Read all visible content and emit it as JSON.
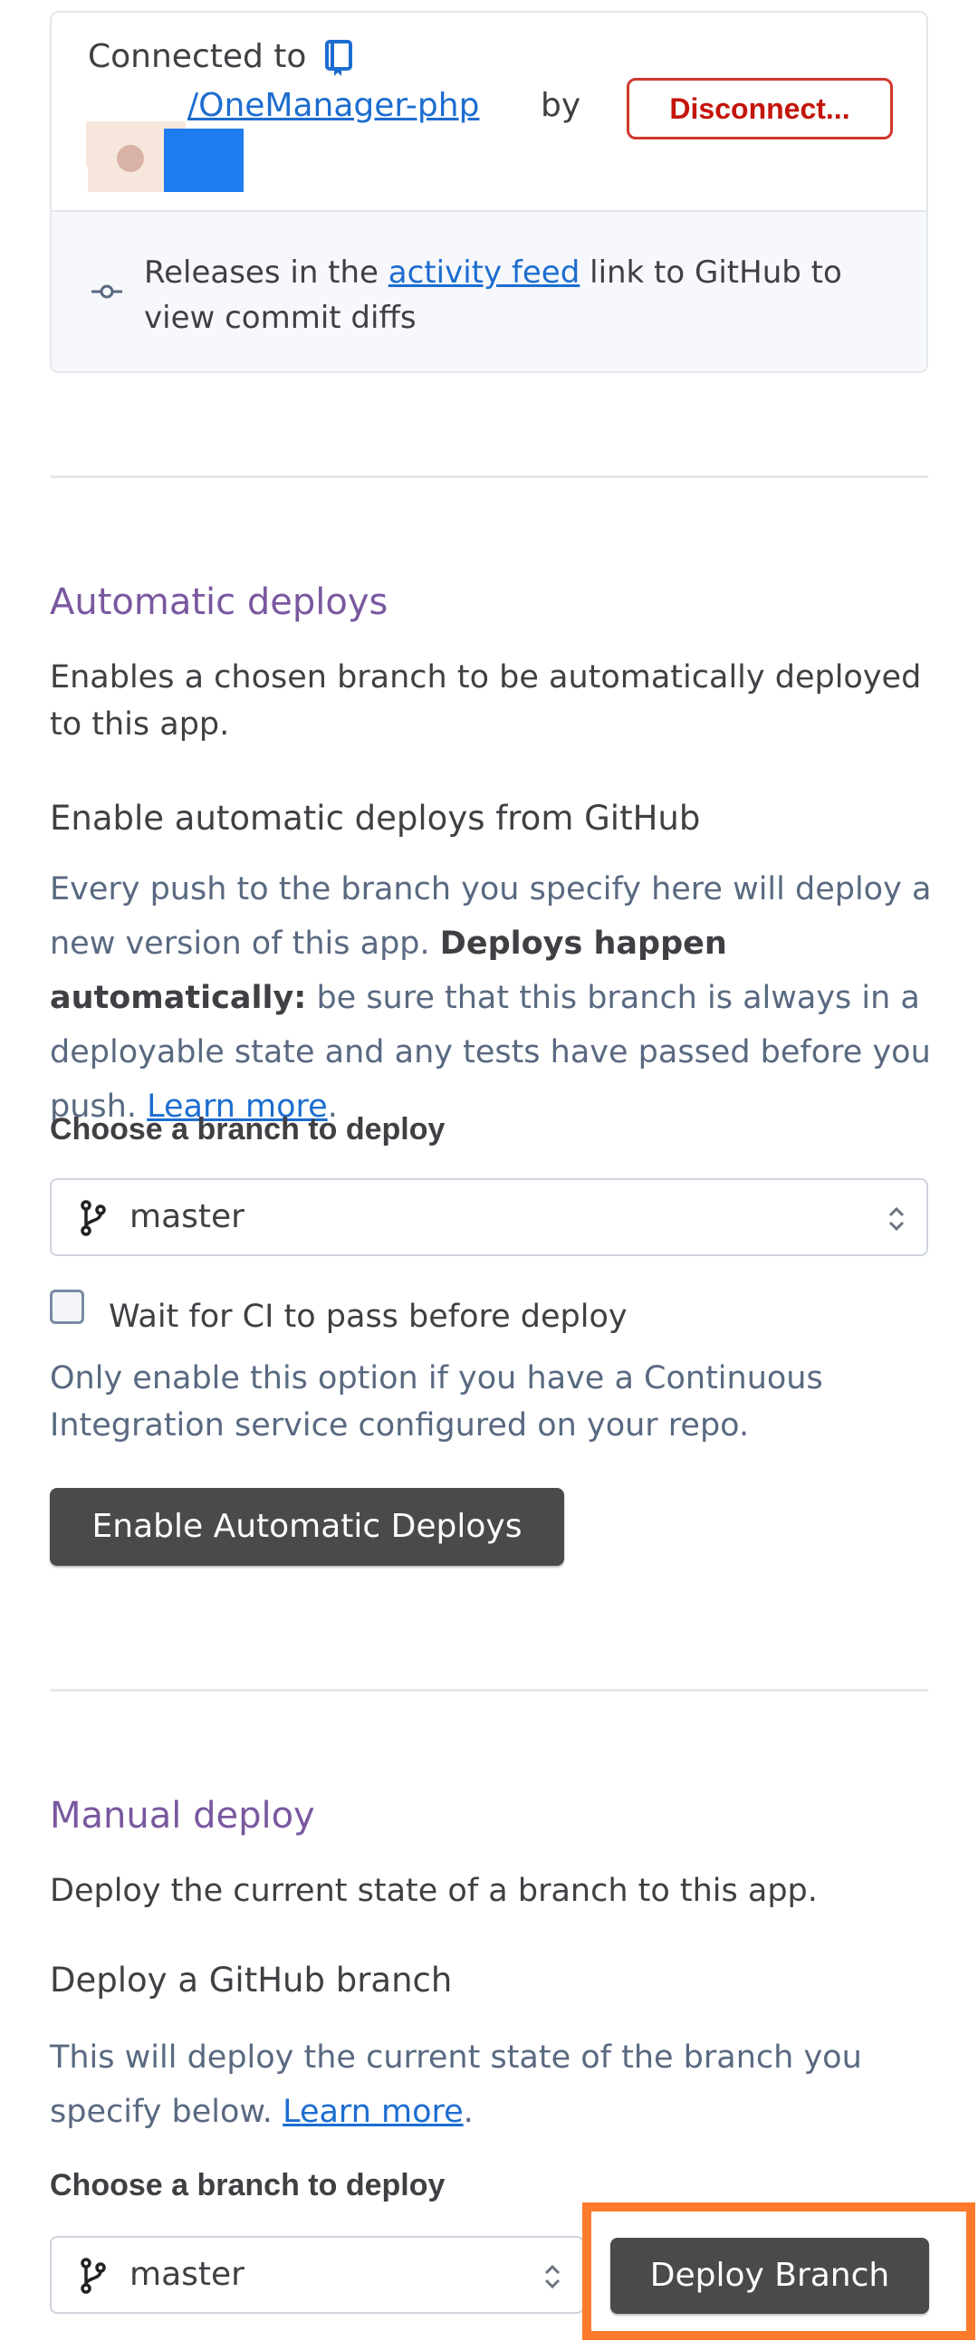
{
  "github_connection": {
    "connected_label": "Connected to",
    "repo_name": "/OneManager-php",
    "by_label": "by",
    "disconnect_label": "Disconnect...",
    "release_text_prefix": "Releases in the ",
    "activity_feed_link": "activity feed",
    "release_text_suffix": " link to GitHub to view commit diffs"
  },
  "automatic_deploys": {
    "title": "Automatic deploys",
    "description": "Enables a chosen branch to be automatically deployed to this app.",
    "subheading": "Enable automatic deploys from GitHub",
    "info_prefix": "Every push to the branch you specify here will deploy a new version of this app. ",
    "info_bold": "Deploys happen automatically:",
    "info_suffix": " be sure that this branch is always in a deployable state and any tests have passed before you push. ",
    "learn_more": "Learn more",
    "branch_label": "Choose a branch to deploy",
    "branch_value": "master",
    "ci_checkbox_label": "Wait for CI to pass before deploy",
    "ci_checkbox_checked": false,
    "ci_note": "Only enable this option if you have a Continuous Integration service configured on your repo.",
    "enable_button": "Enable Automatic Deploys"
  },
  "manual_deploy": {
    "title": "Manual deploy",
    "description": "Deploy the current state of a branch to this app.",
    "subheading": "Deploy a GitHub branch",
    "info_prefix": "This will deploy the current state of the branch you specify below. ",
    "learn_more": "Learn more",
    "branch_label": "Choose a branch to deploy",
    "branch_value": "master",
    "deploy_button": "Deploy Branch"
  },
  "colors": {
    "section_title": "#79589f",
    "link": "#1c6dd0",
    "danger": "#c4150b",
    "button_dark": "#4a4a4d",
    "highlight": "#ff7a2a"
  }
}
